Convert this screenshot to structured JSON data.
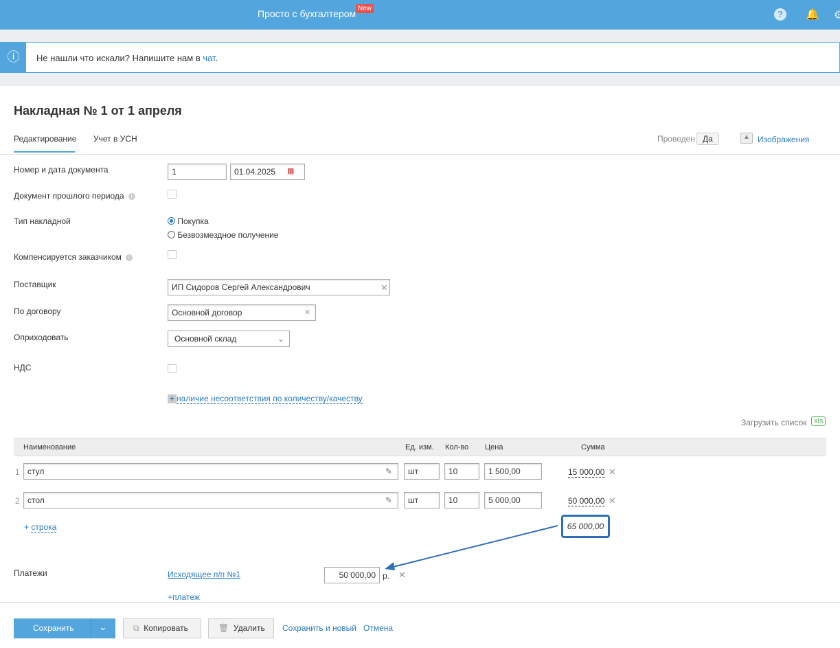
{
  "header": {
    "brand": "Просто с бухгалтером",
    "new_badge": "New",
    "icons": [
      "help-icon",
      "bell-icon",
      "settings-icon"
    ]
  },
  "info": {
    "text": "Не нашли что искали? Напишите нам в ",
    "link": "чат",
    "suffix": "."
  },
  "page": {
    "title": "Накладная № 1 от 1 апреля"
  },
  "tabs": [
    {
      "label": "Редактирование",
      "active": true
    },
    {
      "label": "Учет в УСН"
    }
  ],
  "status": {
    "label": "Проведен",
    "value": "Да",
    "images_link": "Изображения"
  },
  "form": {
    "doc_number_label": "Номер и дата документа",
    "doc_number": "1",
    "doc_date": "01.04.2025",
    "past_period_label": "Документ прошлого периода",
    "type_label": "Тип накладной",
    "type_options": [
      "Покупка",
      "Безвозмездное получение"
    ],
    "type_selected": "Покупка",
    "compensated_label": "Компенсируется заказчиком",
    "supplier_label": "Поставщик",
    "supplier": "ИП  Сидоров Сергей Александрович",
    "contract_label": "По договору",
    "contract": "Основной договор",
    "receive_label": "Оприходовать",
    "warehouse": "Основной склад",
    "vat_label": "НДС",
    "discrepancy_link": "наличие несоответствия по количеству/качеству"
  },
  "items": {
    "upload_label": "Загрузить список",
    "upload_badge": "xls",
    "columns": [
      "Наименование",
      "Ед. изм.",
      "Кол-во",
      "Цена",
      "Сумма"
    ],
    "rows": [
      {
        "n": "1",
        "name": "стул",
        "unit": "шт",
        "qty": "10",
        "price": "1 500,00",
        "sum": "15 000,00"
      },
      {
        "n": "2",
        "name": "стол",
        "unit": "шт",
        "qty": "10",
        "price": "5 000,00",
        "sum": "50 000,00"
      }
    ],
    "add_row": "строка",
    "total": "65 000,00"
  },
  "payments": {
    "label": "Платежи",
    "link": "Исходящее п/п №1",
    "amount": "50 000,00",
    "currency": "р.",
    "add": "платеж"
  },
  "footer": {
    "save": "Сохранить",
    "copy": "Копировать",
    "delete": "Удалить",
    "save_new": "Сохранить и новый",
    "cancel": "Отмена"
  },
  "annotation": {
    "color": "#2f6fb5"
  }
}
